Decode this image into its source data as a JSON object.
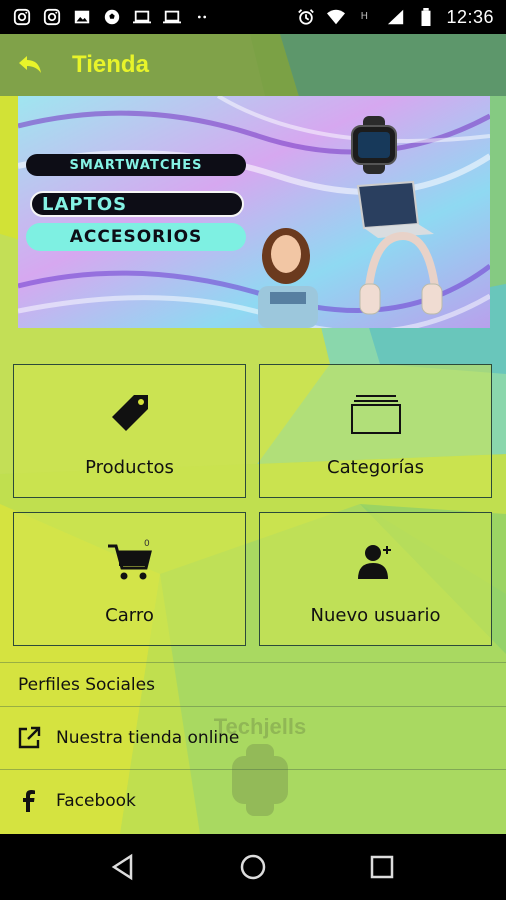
{
  "status_bar": {
    "time": "12:36",
    "left_icons": [
      "instagram-icon",
      "instagram-icon",
      "image-icon",
      "soccer-ball-icon",
      "laptop-icon",
      "laptop-icon",
      "more-icon"
    ],
    "right_icons": [
      "alarm-icon",
      "wifi-icon",
      "signal-h-icon",
      "signal-icon",
      "battery-icon"
    ]
  },
  "appbar": {
    "title": "Tienda"
  },
  "banner": {
    "labels": [
      "SMARTWATCHES",
      "LAPTOS",
      "ACCESORIOS"
    ]
  },
  "tiles": [
    {
      "label": "Productos",
      "icon": "tag-icon"
    },
    {
      "label": "Categorías",
      "icon": "folders-icon"
    },
    {
      "label": "Carro",
      "icon": "cart-icon"
    },
    {
      "label": "Nuevo usuario",
      "icon": "add-user-icon"
    }
  ],
  "social": {
    "title": "Perfiles Sociales",
    "items": [
      {
        "label": "Nuestra tienda online",
        "icon": "external-link-icon"
      },
      {
        "label": "Facebook",
        "icon": "facebook-icon"
      }
    ]
  },
  "watermark": {
    "text": "Techjells"
  },
  "colors": {
    "accent_yellow": "#e8f42a",
    "lime": "#c9e42a",
    "cyan": "#58c9c3",
    "status_bar": "#000000"
  }
}
